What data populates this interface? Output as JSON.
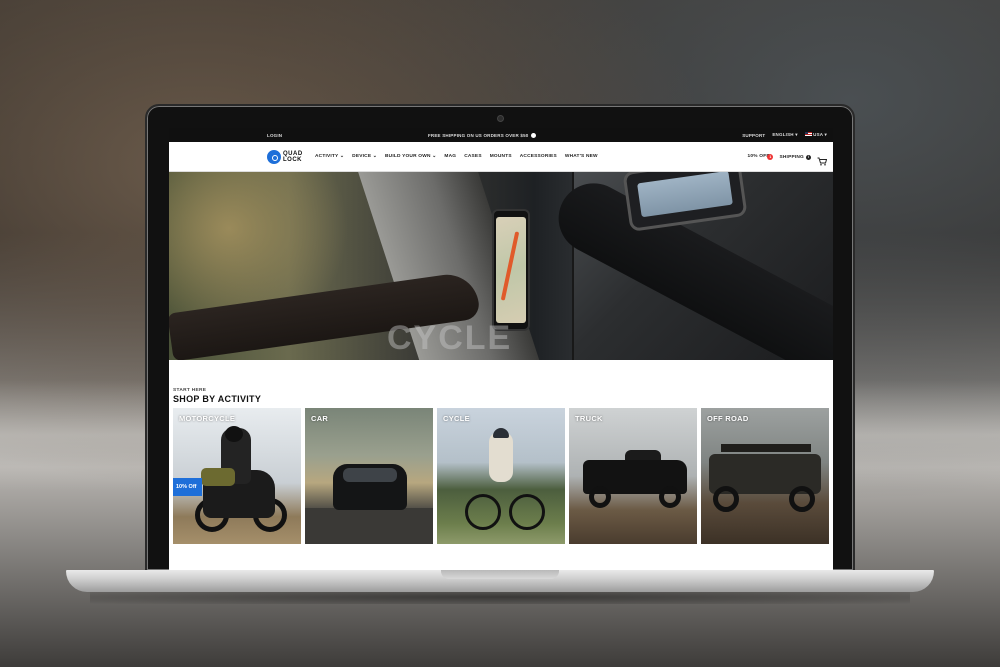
{
  "topbar": {
    "login": "LOGIN",
    "shipping_notice": "FREE SHIPPING ON US ORDERS OVER $50",
    "support": "SUPPORT",
    "language": "ENGLISH",
    "region": "USA"
  },
  "nav": {
    "logo_line1": "QUAD",
    "logo_line2": "LOCK",
    "items": [
      "ACTIVITY",
      "DEVICE",
      "BUILD YOUR OWN",
      "MAG",
      "CASES",
      "MOUNTS",
      "ACCESSORIES",
      "WHAT'S NEW"
    ],
    "promo": "10% OFF",
    "promo_count": "1",
    "shipping": "SHIPPING",
    "shipping_count": "i"
  },
  "hero": {
    "title": "CYCLE"
  },
  "shop": {
    "kicker": "START HERE",
    "heading": "SHOP BY ACTIVITY",
    "tiles": [
      {
        "label": "MOTORCYCLE",
        "badge": "10% Off"
      },
      {
        "label": "CAR"
      },
      {
        "label": "CYCLE"
      },
      {
        "label": "TRUCK"
      },
      {
        "label": "OFF ROAD"
      }
    ]
  },
  "colors": {
    "brand_blue": "#1e6fd9",
    "topbar_bg": "#101010",
    "badge_red": "#e33333"
  }
}
